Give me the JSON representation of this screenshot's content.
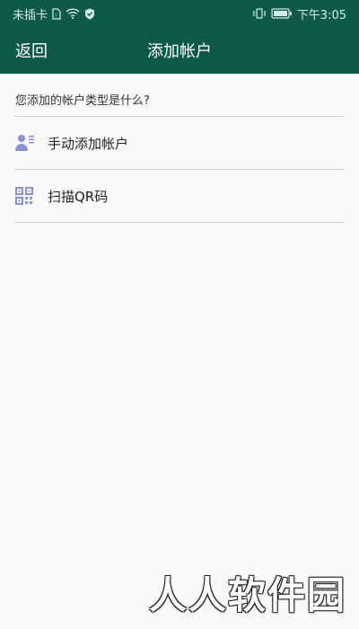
{
  "status_bar": {
    "carrier": "未插卡",
    "time": "下午3:05"
  },
  "app_bar": {
    "back_label": "返回",
    "title": "添加帐户"
  },
  "prompt": "您添加的帐户类型是什么?",
  "options": [
    {
      "label": "手动添加帐户",
      "icon": "person-card-icon"
    },
    {
      "label": "扫描QR码",
      "icon": "qr-code-icon"
    }
  ],
  "watermark": "人人软件园",
  "colors": {
    "app_bar": "#0e5a4a",
    "icon_accent": "#8a8fd8"
  }
}
